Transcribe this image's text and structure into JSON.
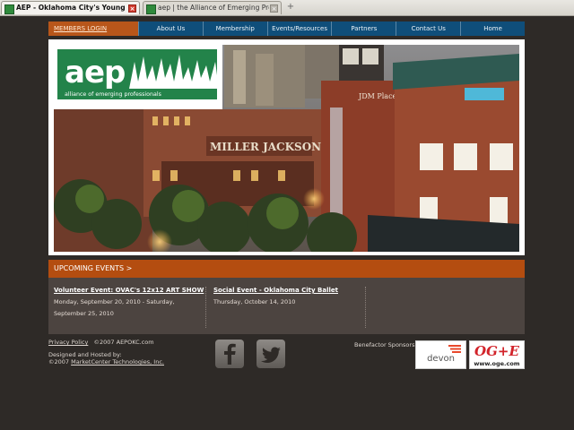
{
  "browser": {
    "tabs": [
      {
        "title": "AEP - Oklahoma City's Young Prof...",
        "close": "×"
      },
      {
        "title": "aep | the Alliance of Emerging Professi...",
        "close": "×"
      }
    ],
    "new_tab": "+"
  },
  "nav": {
    "members_login": "MEMBERS LOGIN",
    "items": [
      "About Us",
      "Membership",
      "Events/Resources",
      "Partners",
      "Contact Us",
      "Home"
    ]
  },
  "hero": {
    "logo": {
      "letters": "aep",
      "tagline": "alliance of emerging professionals"
    },
    "icon": "aep-logo-icon"
  },
  "events": {
    "header": "UPCOMING EVENTS >",
    "list": [
      {
        "title": "Volunteer Event: OVAC's 12x12 ART SHOW",
        "date": "Monday, September 20, 2010 - Saturday, September 25, 2010"
      },
      {
        "title": "Social Event - Oklahoma City Ballet",
        "date": "Thursday, October 14, 2010"
      }
    ]
  },
  "footer": {
    "privacy_policy": "Privacy Policy",
    "copyright": "©2007 AEPOKC.com",
    "designed_by": "Designed and Hosted by:",
    "designer_copyright": "©2007",
    "designer": "MarketCenter Technologies, Inc.",
    "sponsors_label": "Benefactor Sponsors :",
    "sponsors": {
      "devon": "devon",
      "oge_logo": "OG+E",
      "oge_url": "www.oge.com"
    }
  },
  "colors": {
    "nav": "#0f4e7a",
    "accent_orange": "#b44d10",
    "logo_green": "#23834a",
    "background": "#2e2a27"
  }
}
